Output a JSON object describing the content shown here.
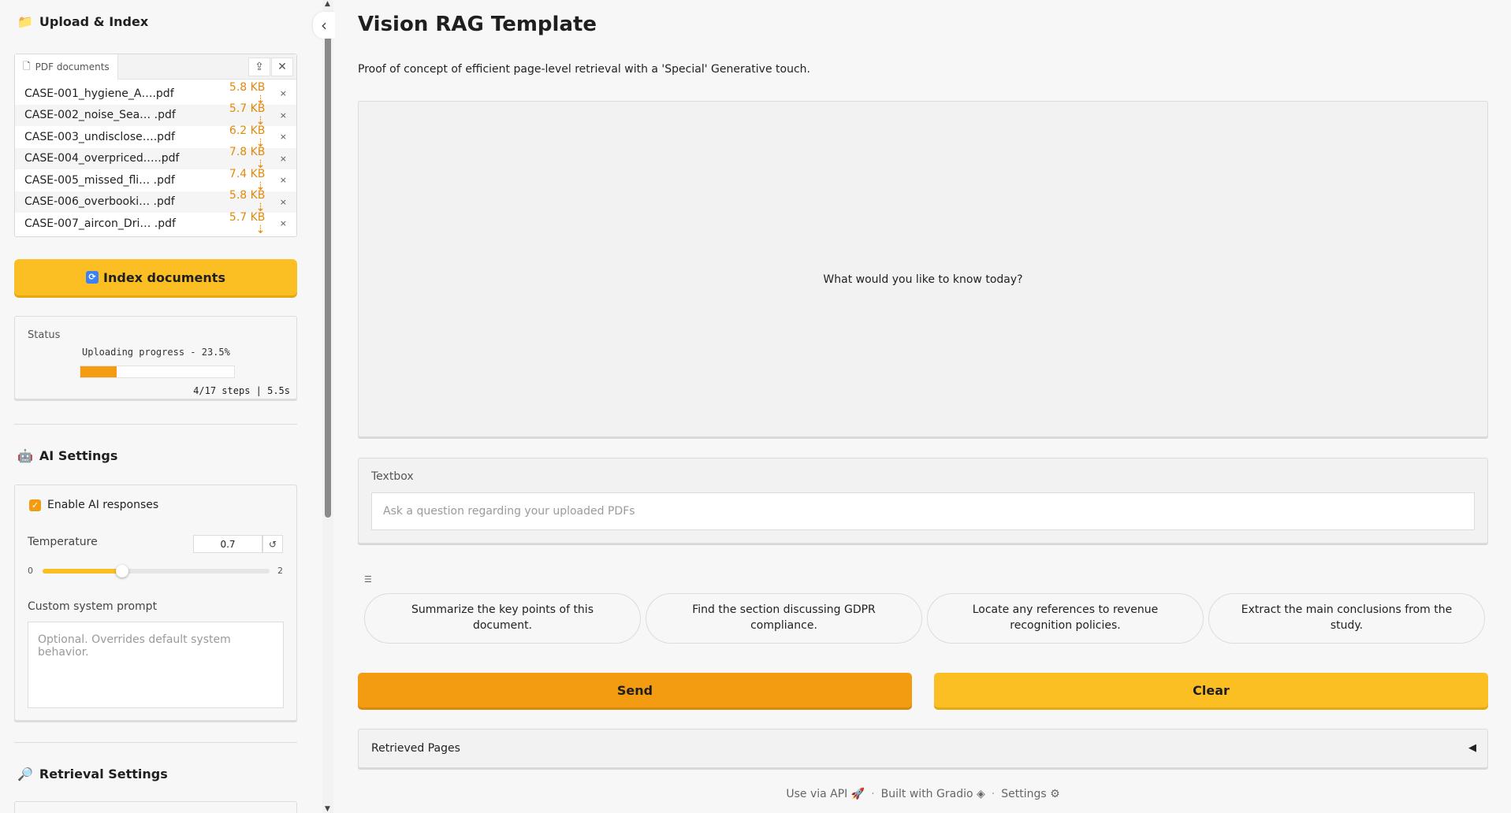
{
  "sidebar": {
    "upload_header": "Upload & Index",
    "upload_icon": "folder-icon",
    "file_tab": "PDF documents",
    "files": [
      {
        "name": "CASE-001_hygiene_A….pdf",
        "size": "5.8 KB ⇣"
      },
      {
        "name": "CASE-002_noise_Sea… .pdf",
        "size": "5.7 KB ⇣"
      },
      {
        "name": "CASE-003_undisclose….pdf",
        "size": "6.2 KB ⇣"
      },
      {
        "name": "CASE-004_overpriced.….pdf",
        "size": "7.8 KB ⇣"
      },
      {
        "name": "CASE-005_missed_fli… .pdf",
        "size": "7.4 KB ⇣"
      },
      {
        "name": "CASE-006_overbooki… .pdf",
        "size": "5.8 KB ⇣"
      },
      {
        "name": "CASE-007_aircon_Dri… .pdf",
        "size": "5.7 KB ⇣"
      }
    ],
    "index_button": "Index documents",
    "status": {
      "label": "Status",
      "progress_text": "Uploading progress - 23.5%",
      "progress_fraction": 0.235,
      "steps": "4/17 steps | 5.5s"
    },
    "ai_header": "AI Settings",
    "ai": {
      "enable_label": "Enable AI responses",
      "enabled": true,
      "temperature_label": "Temperature",
      "temperature_value": "0.7",
      "temperature_min": "0",
      "temperature_max": "2",
      "temperature_fraction": 0.35,
      "prompt_label": "Custom system prompt",
      "prompt_placeholder": "Optional. Overrides default system behavior."
    },
    "retrieval_header": "Retrieval Settings"
  },
  "main": {
    "title": "Vision RAG Template",
    "subtitle": "Proof of concept of efficient page-level retrieval with a 'Special' Generative touch.",
    "chat_placeholder": "What would you like to know today?",
    "textbox_label": "Textbox",
    "textbox_placeholder": "Ask a question regarding your uploaded PDFs",
    "examples": [
      "Summarize the key points of this document.",
      "Find the section discussing GDPR compliance.",
      "Locate any references to revenue recognition policies.",
      "Extract the main conclusions from the study."
    ],
    "send": "Send",
    "clear": "Clear",
    "retrieved": "Retrieved Pages",
    "footer": {
      "api": "Use via API",
      "built": "Built with Gradio",
      "settings": "Settings"
    }
  },
  "colors": {
    "accent": "#fbbf24",
    "primary": "#f39c12",
    "file_size": "#e38a0b"
  }
}
